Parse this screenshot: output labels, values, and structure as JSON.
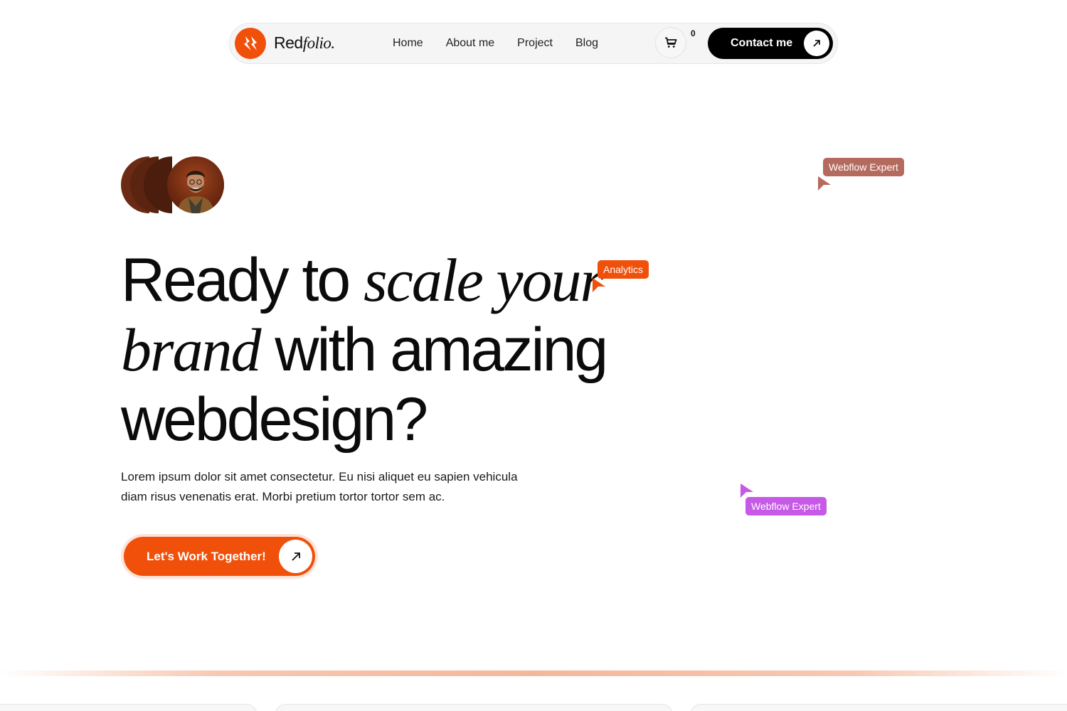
{
  "brand": {
    "name_plain": "Red",
    "name_italic": "folio.",
    "accent_color": "#f0500a"
  },
  "nav": {
    "links": [
      "Home",
      "About me",
      "Project",
      "Blog"
    ],
    "cart_count": "0",
    "contact_label": "Contact me"
  },
  "hero": {
    "line1_plain": "Ready to",
    "line1_italic": "scale your",
    "line2_italic": "brand",
    "line2_plain": "with amazing",
    "line3_plain": "webdesign?",
    "description_line1": "Lorem ipsum dolor sit amet consectetur. Eu nisi aliquet eu sapien vehicula",
    "description_line2": "diam risus venenatis erat. Morbi pretium tortor tortor sem ac.",
    "cta_label": "Let's Work Together!"
  },
  "tags": [
    {
      "label": "Analytics",
      "color": "#f0500a"
    },
    {
      "label": "Webflow Expert",
      "color": "#b56a5e"
    },
    {
      "label": "Webflow Expert",
      "color": "#c659e6"
    }
  ],
  "icons": {
    "logo": "redfolio-logo-icon",
    "cart": "cart-icon",
    "arrow": "arrow-up-right-icon",
    "pointer": "cursor-pointer-icon"
  }
}
